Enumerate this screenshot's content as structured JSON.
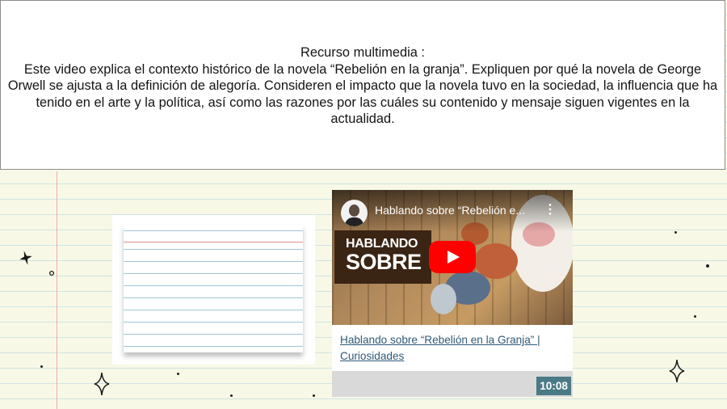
{
  "instruction": {
    "heading": "Recurso multimedia :",
    "body": "Este video explica el contexto histórico de la novela “Rebelión en la granja”. Expliquen por qué la novela de George Orwell se ajusta a la definición de alegoría. Consideren el impacto que la novela tuvo en la sociedad, la influencia que ha tenido en el arte y la política, así como las razones por las cuáles su contenido y mensaje siguen vigentes en la actualidad."
  },
  "video": {
    "overlay_title": "Hablando sobre “Rebelión e...",
    "thumbnail_text_line1": "HABLANDO",
    "thumbnail_text_line2": "SOBRE",
    "link_text": "Hablando sobre “Rebelión en la Granja” | Curiosidades",
    "duration": "10:08",
    "icons": {
      "play": "play-icon",
      "menu": "more-vert-icon",
      "channel": "channel-avatar-icon"
    },
    "accent_color": "#ff0000",
    "link_color": "#2f5a78",
    "duration_bg": "#4a7a86"
  },
  "colors": {
    "paper": "#f7f9e6",
    "ruled_line": "#cfe3e3",
    "margin_line": "#f2a7a7"
  }
}
